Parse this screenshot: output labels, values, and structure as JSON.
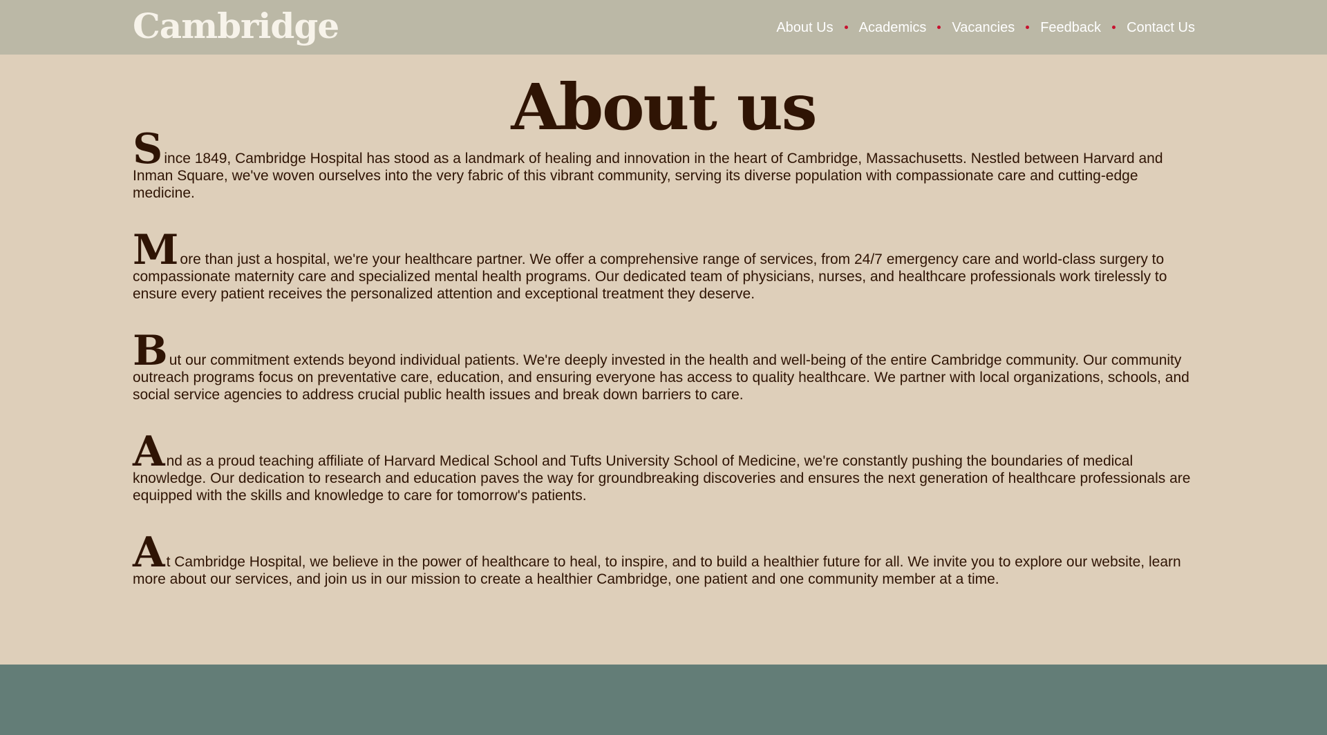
{
  "header": {
    "logo": "Cambridge",
    "nav": [
      {
        "label": "About Us"
      },
      {
        "label": "Academics"
      },
      {
        "label": "Vacancies"
      },
      {
        "label": "Feedback"
      },
      {
        "label": "Contact Us"
      }
    ]
  },
  "main": {
    "title": "About us",
    "paragraphs": [
      {
        "initial": "S",
        "text": "ince 1849, Cambridge Hospital has stood as a landmark of healing and innovation in the heart of Cambridge, Massachusetts. Nestled between Harvard and Inman Square, we've woven ourselves into the very fabric of this vibrant community, serving its diverse population with compassionate care and cutting-edge medicine."
      },
      {
        "initial": "M",
        "text": "ore than just a hospital, we're your healthcare partner. We offer a comprehensive range of services, from 24/7 emergency care and world-class surgery to compassionate maternity care and specialized mental health programs. Our dedicated team of physicians, nurses, and healthcare professionals work tirelessly to ensure every patient receives the personalized attention and exceptional treatment they deserve."
      },
      {
        "initial": "B",
        "text": "ut our commitment extends beyond individual patients. We're deeply invested in the health and well-being of the entire Cambridge community. Our community outreach programs focus on preventative care, education, and ensuring everyone has access to quality healthcare. We partner with local organizations, schools, and social service agencies to address crucial public health issues and break down barriers to care."
      },
      {
        "initial": "A",
        "text": "nd as a proud teaching affiliate of Harvard Medical School and Tufts University School of Medicine, we're constantly pushing the boundaries of medical knowledge. Our dedication to research and education paves the way for groundbreaking discoveries and ensures the next generation of healthcare professionals are equipped with the skills and knowledge to care for tomorrow's patients."
      },
      {
        "initial": "A",
        "text": "t Cambridge Hospital, we believe in the power of healthcare to heal, to inspire, and to build a healthier future for all. We invite you to explore our website, learn more about our services, and join us in our mission to create a healthier Cambridge, one patient and one community member at a time."
      }
    ]
  },
  "colors": {
    "header_bg": "#bbb8a6",
    "page_bg": "#decfba",
    "text": "#2f1404",
    "nav_separator": "#c8102e",
    "footer_bg": "#637d77"
  }
}
